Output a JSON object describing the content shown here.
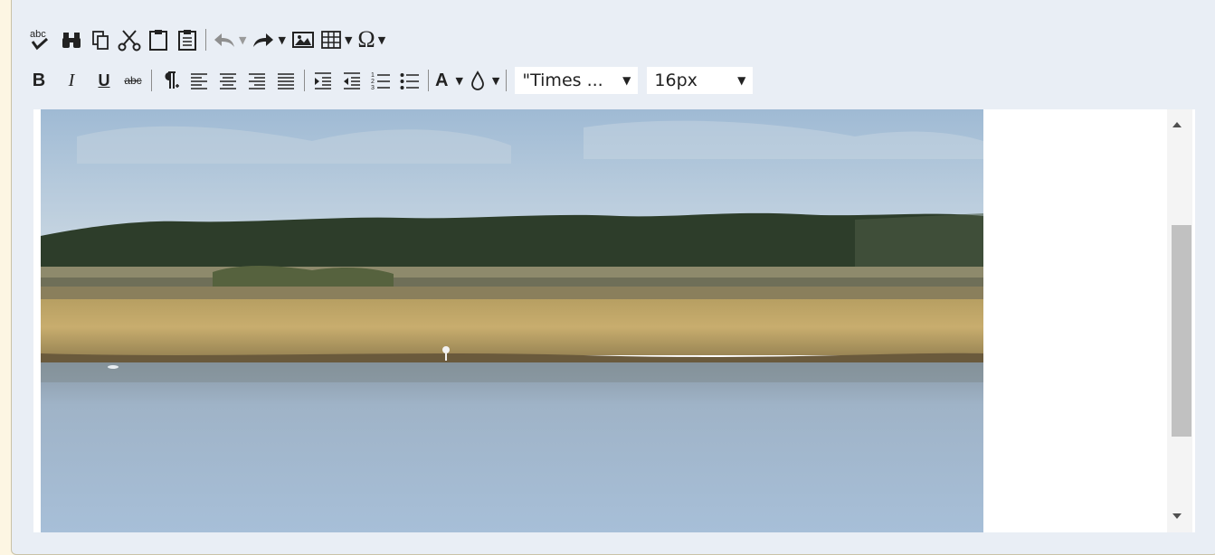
{
  "toolbar": {
    "row1": [
      {
        "name": "spellcheck-icon",
        "tip": "spell check"
      },
      {
        "name": "find-icon",
        "tip": "find"
      },
      {
        "name": "copy-icon",
        "tip": "copy"
      },
      {
        "name": "cut-icon",
        "tip": "cut"
      },
      {
        "name": "paste-icon",
        "tip": "paste"
      },
      {
        "name": "paste-text-icon",
        "tip": "paste text"
      },
      {
        "name": "undo-icon",
        "tip": "undo"
      },
      {
        "name": "redo-icon",
        "tip": "redo"
      },
      {
        "name": "image-icon",
        "tip": "insert image"
      },
      {
        "name": "table-icon",
        "tip": "insert table"
      },
      {
        "name": "special-char-icon",
        "tip": "special character"
      }
    ],
    "spellcheck_label": "abc",
    "bold_label": "B",
    "italic_label": "I",
    "underline_label": "U",
    "strike_label": "abc",
    "font_family": "\"Times ...",
    "font_size": "16px",
    "omega_label": "Ω",
    "text_color_label": "A"
  },
  "colors": {
    "page_bg": "#fdf6e3",
    "toolbar_bg": "#e9eef5",
    "editor_bg": "#ffffff",
    "scroll_thumb": "#c1c1c1"
  },
  "editor": {
    "content": "landscape-photo-marsh",
    "scroll_position": 0.35
  }
}
